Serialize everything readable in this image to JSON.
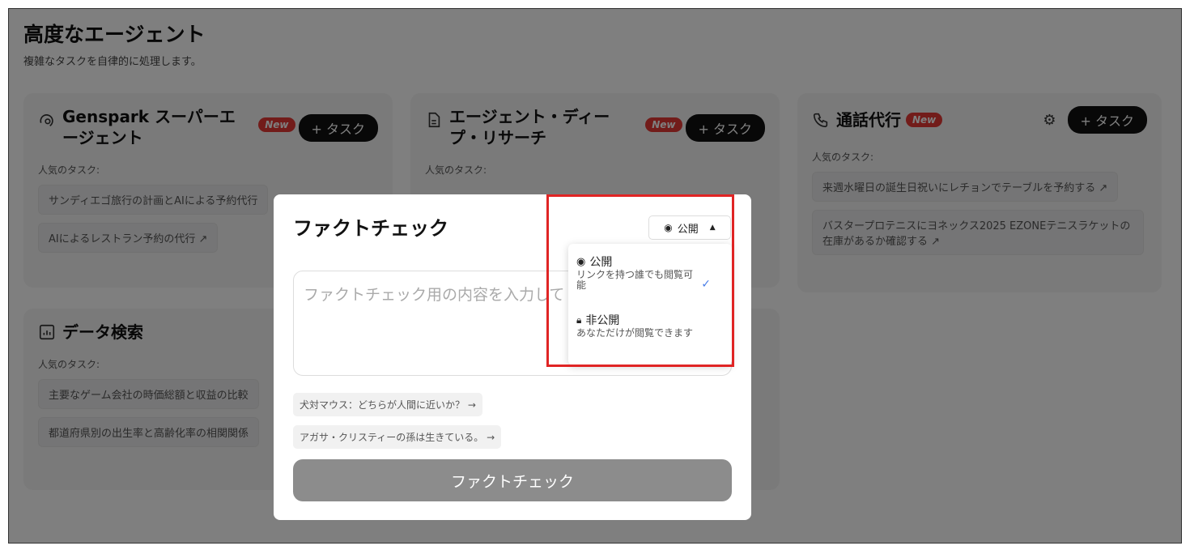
{
  "page": {
    "title": "高度なエージェント",
    "subtitle": "複雑なタスクを自律的に処理します。"
  },
  "cards": {
    "super_agent": {
      "title": "Genspark スーパーエージェント",
      "badge": "New",
      "task_button": "+ タスク",
      "popular_label": "人気のタスク:",
      "tasks": [
        "サンディエゴ旅行の計画とAIによる予約代行",
        "AIによるレストラン予約の代行 ↗"
      ]
    },
    "deep_research": {
      "title": "エージェント・ディープ・リサーチ",
      "badge": "New",
      "task_button": "+ タスク",
      "popular_label": "人気のタスク:"
    },
    "call_agent": {
      "title": "通話代行",
      "badge": "New",
      "task_button": "+ タスク",
      "popular_label": "人気のタスク:",
      "tasks": [
        "来週水曜日の誕生日祝いにレチョンでテーブルを予約する ↗",
        "バスタープロテニスにヨネックス2025 EZONEテニスラケットの在庫があるか確認する ↗"
      ]
    },
    "data_search": {
      "title": "データ検索",
      "popular_label": "人気のタスク:",
      "tasks": [
        "主要なゲーム会社の時価総額と収益の比較",
        "都道府県別の出生率と高齢化率の相関関係"
      ]
    }
  },
  "modal": {
    "title": "ファクトチェック",
    "visibility_selected": "公開",
    "input_placeholder": "ファクトチェック用の内容を入力して",
    "suggestions": [
      "犬対マウス：どちらが人間に近いか？ →",
      "アガサ・クリスティーの孫は生きている。 →"
    ],
    "submit_label": "ファクトチェック",
    "dropdown": {
      "options": [
        {
          "label": "公開",
          "description": "リンクを持つ誰でも閲覧可能",
          "selected": true
        },
        {
          "label": "非公開",
          "description": "あなただけが閲覧できます",
          "selected": false
        }
      ]
    }
  },
  "colors": {
    "accent_badge": "#e53935",
    "highlight": "#e02424",
    "check": "#4a7ee8",
    "submit_disabled": "#8c8c8c"
  }
}
